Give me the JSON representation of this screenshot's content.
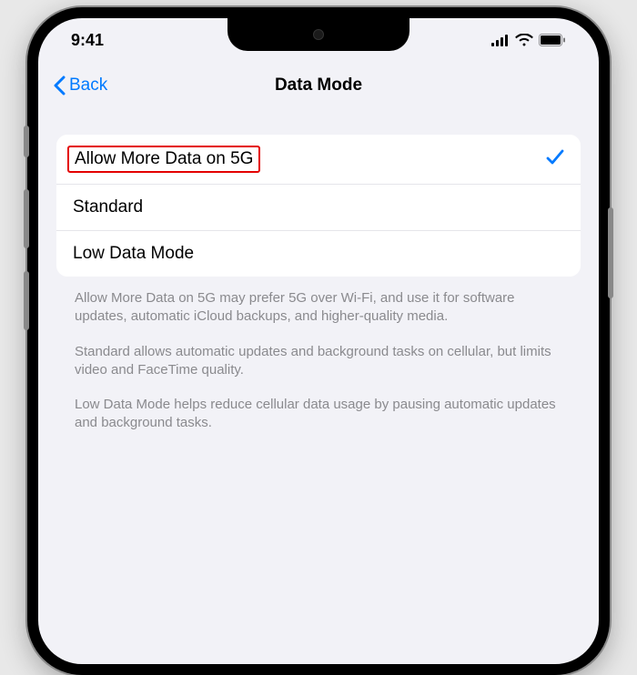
{
  "status": {
    "time": "9:41"
  },
  "nav": {
    "back_label": "Back",
    "title": "Data Mode"
  },
  "options": [
    {
      "label": "Allow More Data on 5G",
      "selected": true,
      "highlighted": true
    },
    {
      "label": "Standard",
      "selected": false,
      "highlighted": false
    },
    {
      "label": "Low Data Mode",
      "selected": false,
      "highlighted": false
    }
  ],
  "footer": {
    "p1": "Allow More Data on 5G may prefer 5G over Wi-Fi, and use it for software updates, automatic iCloud backups, and higher-quality media.",
    "p2": "Standard allows automatic updates and background tasks on cellular, but limits video and FaceTime quality.",
    "p3": "Low Data Mode helps reduce cellular data usage by pausing automatic updates and background tasks."
  }
}
